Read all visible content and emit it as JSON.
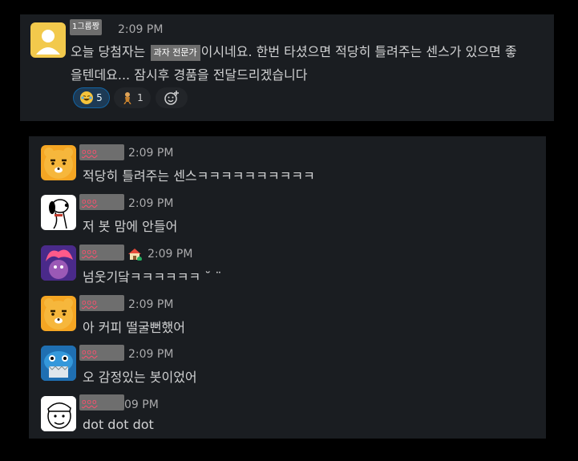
{
  "top": {
    "author": "1그룹짱",
    "time": "2:09 PM",
    "line1_a": "오늘 당첨자는",
    "line1_redact": "과자 전문가",
    "line1_b": "이시네요. 한번 타셨으면 적당히 틀려주는 센스가 있으면 좋",
    "line2": "을텐데요... 잠시후 경품을 전달드리겠습니다",
    "reactions": [
      {
        "emoji": "joy-emoji",
        "count": "5"
      },
      {
        "emoji": "monkey-emoji",
        "count": "1"
      }
    ]
  },
  "messages": [
    {
      "author": "ooo",
      "time": "2:09 PM",
      "text": "적당히 틀려주는 센스ㅋㅋㅋㅋㅋㅋㅋㅋㅋㅋ",
      "avatar": "ryan-avatar"
    },
    {
      "author": "ooo",
      "time": "2:09 PM",
      "text": "저 봇 맘에 안들어",
      "avatar": "snoopy-avatar"
    },
    {
      "author": "ooo",
      "time": "2:09 PM",
      "text": "넘웃기닼ㅋㅋㅋㅋㅋㅋ ˘ ¨",
      "avatar": "troll-avatar",
      "status": "house-emoji"
    },
    {
      "author": "ooo",
      "time": "2:09 PM",
      "text": "아 커피 떨굴뻔했어",
      "avatar": "ryan-avatar"
    },
    {
      "author": "ooo",
      "time": "2:09 PM",
      "text": "오 감정있는 봇이었어",
      "avatar": "shark-avatar"
    },
    {
      "author": "ooo",
      "time": "09 PM",
      "text": "dot dot dot",
      "avatar": "cartoon-face-avatar"
    }
  ],
  "colors": {
    "panel": "#1a1d21",
    "redaction": "#6e6e6e",
    "reaction_active": "#1d3a55",
    "reaction_active_border": "#1264a3"
  }
}
